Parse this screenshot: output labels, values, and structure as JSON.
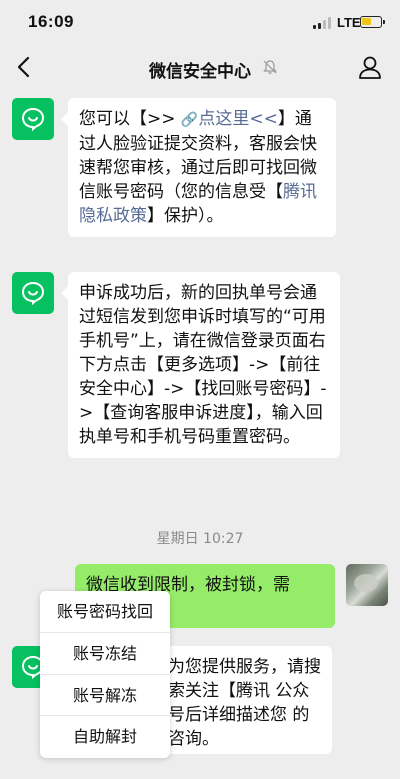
{
  "status_bar": {
    "time": "16:09",
    "network": "LTE"
  },
  "nav": {
    "title": "微信安全中心"
  },
  "messages": [
    {
      "pre": "您可以【>> ",
      "link_icon": "🔗",
      "link": "点这里<<",
      "mid": "】通过人脸验证提交资料，客服会快速帮您审核，通过后即可找回微信账号密码（您的信息受【",
      "link2": "腾讯隐私政策",
      "post": "】保护）。"
    },
    {
      "text": "申诉成功后，新的回执单号会通过短信发到您申诉时填写的“可用手机号”上，请在微信登录页面右下方点击【更多选项】->【前往安全中心】->【找回账号密码】->【查询客服申诉进度】，输入回执单号和手机号码重置密码。"
    },
    {
      "text_fragment": "为您提供服务，请搜索关注【腾讯 公众号后详细描述您 的咨询。"
    }
  ],
  "timestamp": "星期日 10:27",
  "user_message": {
    "text": "微信收到限制，被封锁，需"
  },
  "context_menu": {
    "items": [
      "账号密码找回",
      "账号冻结",
      "账号解冻",
      "自助解封"
    ]
  },
  "colors": {
    "brand_green": "#07c160",
    "bubble_green": "#95ec69",
    "link_blue": "#576b95",
    "background": "#ededed"
  }
}
